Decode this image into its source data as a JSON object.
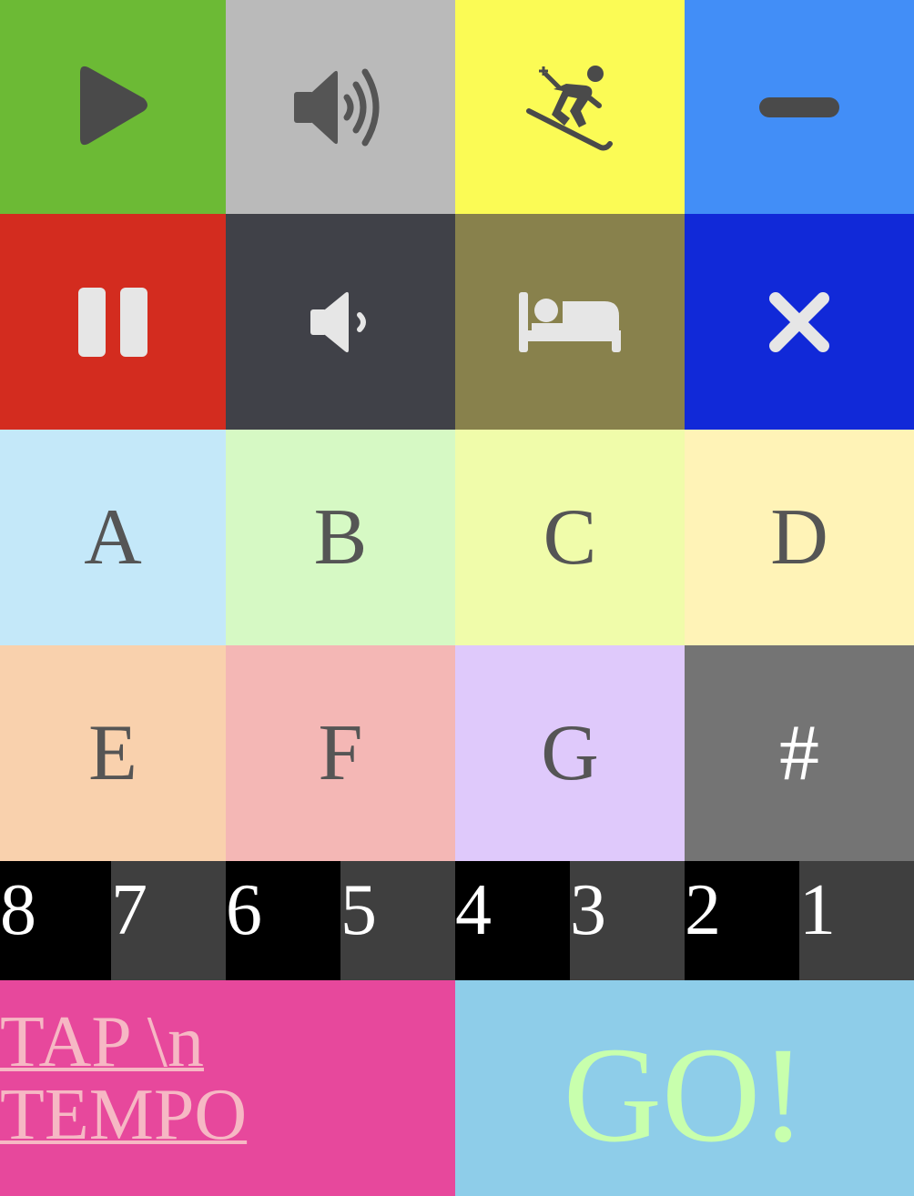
{
  "controls": {
    "row1": [
      {
        "name": "play",
        "icon": "play-icon",
        "bg": "#6cba35"
      },
      {
        "name": "volume-up",
        "icon": "volume-up-icon",
        "bg": "#bababa"
      },
      {
        "name": "ski",
        "icon": "skiing-icon",
        "bg": "#fbfb55"
      },
      {
        "name": "minimize",
        "icon": "minus-icon",
        "bg": "#428ef7"
      }
    ],
    "row2": [
      {
        "name": "pause",
        "icon": "pause-icon",
        "bg": "#d32c1f"
      },
      {
        "name": "volume-down",
        "icon": "volume-down-icon",
        "bg": "#404148"
      },
      {
        "name": "sleep",
        "icon": "bed-icon",
        "bg": "#88814c"
      },
      {
        "name": "close",
        "icon": "close-icon",
        "bg": "#1129d8"
      }
    ]
  },
  "notes": {
    "row1": [
      {
        "label": "A",
        "bg": "#c4e8f9"
      },
      {
        "label": "B",
        "bg": "#d6f9c4"
      },
      {
        "label": "C",
        "bg": "#f0fcaa"
      },
      {
        "label": "D",
        "bg": "#fff3b7"
      }
    ],
    "row2": [
      {
        "label": "E",
        "bg": "#f9d1ad"
      },
      {
        "label": "F",
        "bg": "#f4b7b5"
      },
      {
        "label": "G",
        "bg": "#dfc9fb"
      },
      {
        "label": "#",
        "bg": "#747474"
      }
    ]
  },
  "beats": [
    "8",
    "7",
    "6",
    "5",
    "4",
    "3",
    "2",
    "1"
  ],
  "tap_tempo": {
    "label": "TAP \\n TEMPO",
    "bg": "#e7489c",
    "color": "#f6b8c4"
  },
  "go": {
    "label": "GO!",
    "bg": "#8ecde9",
    "color": "#c8ffad"
  }
}
